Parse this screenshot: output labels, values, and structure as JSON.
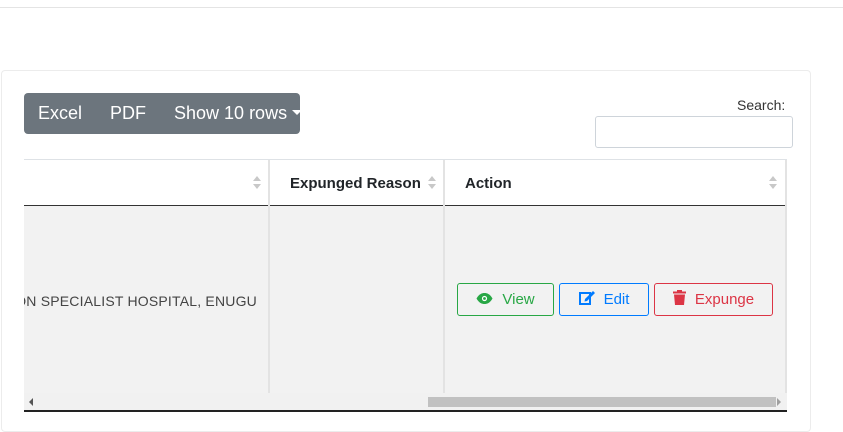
{
  "toolbar": {
    "excel_label": "Excel",
    "pdf_label": "PDF",
    "rows_label": "Show 10 rows"
  },
  "search": {
    "label": "Search:",
    "value": "",
    "placeholder": ""
  },
  "table": {
    "columns": [
      {
        "label": ""
      },
      {
        "label": "Expunged Reason"
      },
      {
        "label": "Action"
      }
    ],
    "rows": [
      {
        "facility": "ON SPECIALIST HOSPITAL, ENUGU",
        "expunged_reason": "",
        "actions": {
          "view": "View",
          "edit": "Edit",
          "expunge": "Expunge"
        }
      }
    ]
  },
  "colors": {
    "toolbar_bg": "#6c757d",
    "view": "#28a745",
    "edit": "#007bff",
    "expunge": "#dc3545",
    "row_bg": "#f2f2f2"
  },
  "icons": {
    "view": "eye-icon",
    "edit": "edit-icon",
    "expunge": "trash-icon"
  },
  "scroll": {
    "horizontal_position": 0.85
  }
}
